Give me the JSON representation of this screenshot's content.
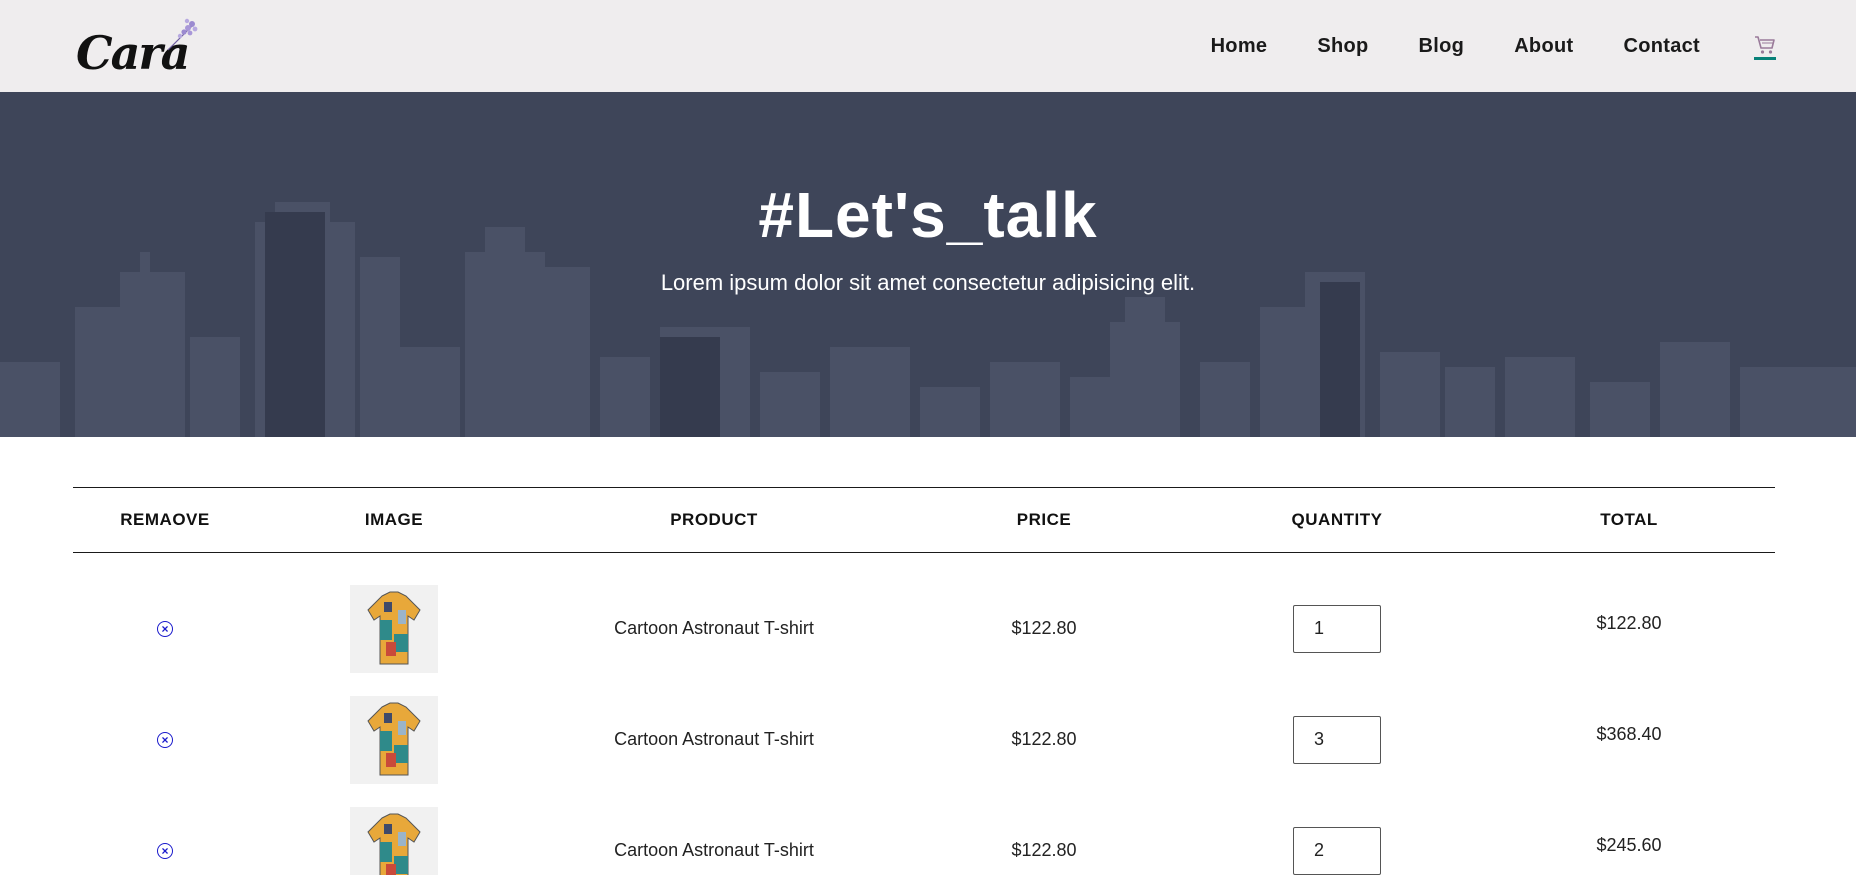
{
  "header": {
    "logo_text": "Cara",
    "nav": [
      {
        "label": "Home"
      },
      {
        "label": "Shop"
      },
      {
        "label": "Blog"
      },
      {
        "label": "About"
      },
      {
        "label": "Contact"
      }
    ],
    "cart_icon": "cart-icon",
    "accent_color": "#088178"
  },
  "hero": {
    "title": "#Let's_talk",
    "subtitle": "Lorem ipsum dolor sit amet consectetur adipisicing elit."
  },
  "table": {
    "headers": {
      "remove": "REMAOVE",
      "image": "IMAGE",
      "product": "PRODUCT",
      "price": "PRICE",
      "quantity": "QUANTITY",
      "total": "TOTAL"
    },
    "rows": [
      {
        "product": "Cartoon Astronaut T-shirt",
        "price": "$122.80",
        "quantity": "1",
        "total": "$122.80"
      },
      {
        "product": "Cartoon Astronaut T-shirt",
        "price": "$122.80",
        "quantity": "3",
        "total": "$368.40"
      },
      {
        "product": "Cartoon Astronaut T-shirt",
        "price": "$122.80",
        "quantity": "2",
        "total": "$245.60"
      }
    ]
  }
}
